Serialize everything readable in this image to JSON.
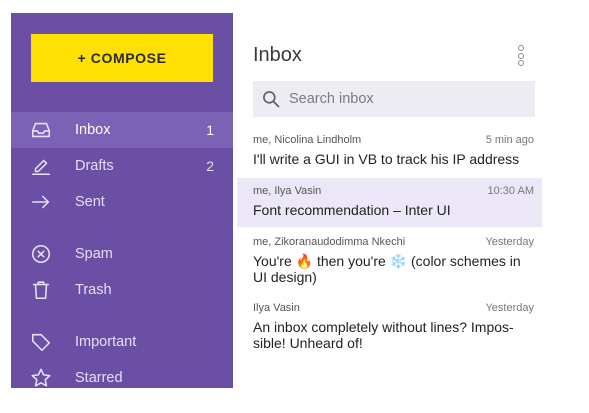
{
  "sidebar": {
    "compose_label": "+ COMPOSE",
    "items": [
      {
        "label": "Inbox",
        "count": "1",
        "icon": "inbox-icon"
      },
      {
        "label": "Drafts",
        "count": "2",
        "icon": "pencil-icon"
      },
      {
        "label": "Sent",
        "count": "",
        "icon": "arrow-right-icon"
      },
      {
        "label": "Spam",
        "count": "",
        "icon": "x-circle-icon"
      },
      {
        "label": "Trash",
        "count": "",
        "icon": "trash-icon"
      },
      {
        "label": "Important",
        "count": "",
        "icon": "tag-icon"
      },
      {
        "label": "Starred",
        "count": "",
        "icon": "star-icon"
      }
    ]
  },
  "main": {
    "title": "Inbox",
    "search_placeholder": "Search inbox",
    "messages": [
      {
        "sender": "me, Nicolina Lindholm",
        "time": "5 min ago",
        "subject": "I'll write a GUI in VB to track his IP address"
      },
      {
        "sender": "me, Ilya Vasin",
        "time": "10:30 AM",
        "subject": "Font recommendation – Inter UI"
      },
      {
        "sender": "me, Zikoranaudodimma Nkechi",
        "time": "Yesterday",
        "subject": "You're 🔥 then you're ❄️ (color schemes in UI design)"
      },
      {
        "sender": "Ilya Vasin",
        "time": "Yesterday",
        "subject": "An inbox completely without lines? Impos-sible! Unheard of!"
      }
    ]
  },
  "colors": {
    "sidebar_bg": "#6b4fa5",
    "sidebar_active": "#7c62b4",
    "compose_bg": "#ffe000",
    "selected_row": "#ece7f7",
    "search_bg": "#ececf2"
  }
}
